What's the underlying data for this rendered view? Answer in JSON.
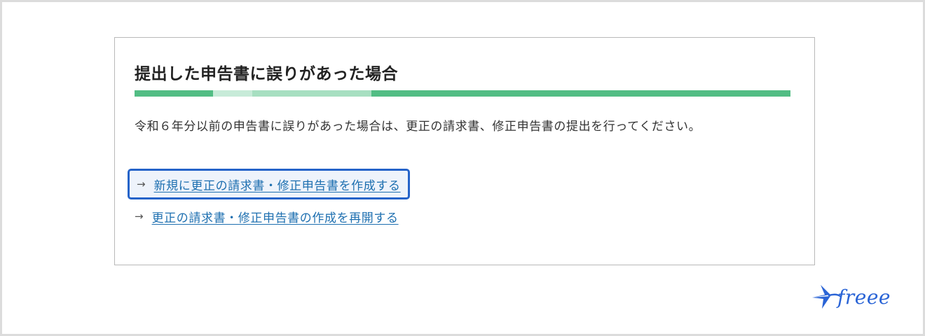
{
  "card": {
    "title": "提出した申告書に誤りがあった場合",
    "progress_segments": [
      {
        "color": "#52bd84",
        "fraction": 0.12
      },
      {
        "color": "#c7ebd8",
        "fraction": 0.059
      },
      {
        "color": "#a7dfc1",
        "fraction": 0.182
      },
      {
        "color": "#52bd84",
        "fraction": 0.639
      }
    ],
    "description": "令和６年分以前の申告書に誤りがあった場合は、更正の請求書、修正申告書の提出を行ってください。",
    "links": [
      {
        "arrow": "→",
        "label": "新規に更正の請求書・修正申告書を作成する",
        "focused": true
      },
      {
        "arrow": "→",
        "label": "更正の請求書・修正申告書の作成を再開する",
        "focused": false
      }
    ]
  },
  "brand": {
    "name": "freee",
    "icon": "freee-bird-icon",
    "color": "#2a64d6"
  }
}
